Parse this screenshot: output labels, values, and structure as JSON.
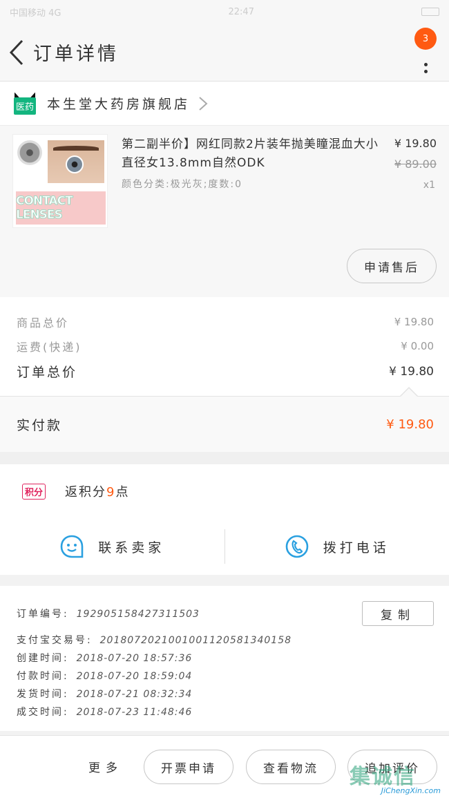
{
  "status_bar": {
    "left": "中国移动 4G",
    "center": "22:47"
  },
  "header": {
    "title": "订单详情",
    "badge_count": "3"
  },
  "shop": {
    "logo_text": "医药",
    "name": "本生堂大药房旗舰店"
  },
  "product": {
    "title": "第二副半价】网红同款2片装年抛美瞳混血大小直径女13.8mm自然ODK",
    "spec": "颜色分类:极光灰;度数:0",
    "price": "¥ 19.80",
    "original_price": "¥ 89.00",
    "quantity": "x1",
    "image_banner": "CONTACT LENSES",
    "after_sale_label": "申请售后"
  },
  "summary": {
    "goods_total_label": "商品总价",
    "goods_total_value": "¥ 19.80",
    "shipping_label": "运费(快递)",
    "shipping_value": "¥ 0.00",
    "order_total_label": "订单总价",
    "order_total_value": "¥ 19.80"
  },
  "paid": {
    "label": "实付款",
    "value": "¥ 19.80"
  },
  "points": {
    "badge": "积分",
    "text_prefix": "返积分",
    "count": "9",
    "text_suffix": "点"
  },
  "contact": {
    "seller_label": "联系卖家",
    "call_label": "拨打电话"
  },
  "order_info": {
    "order_no_label": "订单编号:",
    "order_no": "192905158427311503",
    "copy_label": "复制",
    "alipay_label": "支付宝交易号:",
    "alipay_no": "2018072021001001120581340158",
    "created_label": "创建时间:",
    "created": "2018-07-20 18:57:36",
    "paid_label": "付款时间:",
    "paid": "2018-07-20 18:59:04",
    "shipped_label": "发货时间:",
    "shipped": "2018-07-21 08:32:34",
    "completed_label": "成交时间:",
    "completed": "2018-07-23 11:48:46"
  },
  "actions": {
    "more": "更多",
    "invoice": "开票申请",
    "logistics": "查看物流",
    "review": "追加评价"
  },
  "watermark": {
    "text": "JiChengXin.com",
    "brand": "集诚信"
  },
  "colors": {
    "accent": "#ff5a12",
    "points_red": "#e0245e",
    "icon_blue": "#2aa0e0",
    "medical_green": "#13b57f"
  }
}
